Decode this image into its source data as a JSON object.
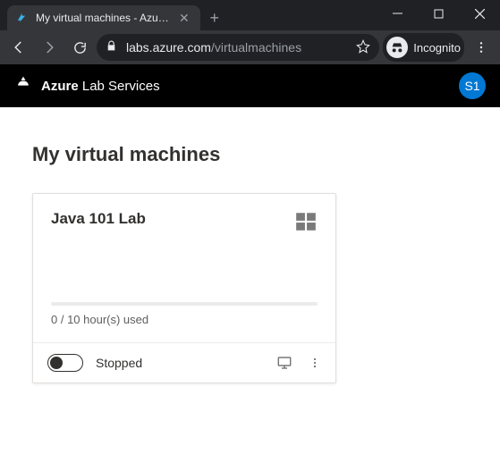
{
  "browser": {
    "tab_title": "My virtual machines - Azure Lab",
    "url_host": "labs.azure.com",
    "url_path": "/virtualmachines",
    "incognito_label": "Incognito"
  },
  "header": {
    "brand_bold": "Azure",
    "brand_rest": "Lab Services",
    "avatar": "S1"
  },
  "page": {
    "title": "My virtual machines"
  },
  "vm": {
    "name": "Java 101 Lab",
    "os_icon": "windows-icon",
    "usage_text": "0 / 10 hour(s) used",
    "status": "Stopped"
  }
}
